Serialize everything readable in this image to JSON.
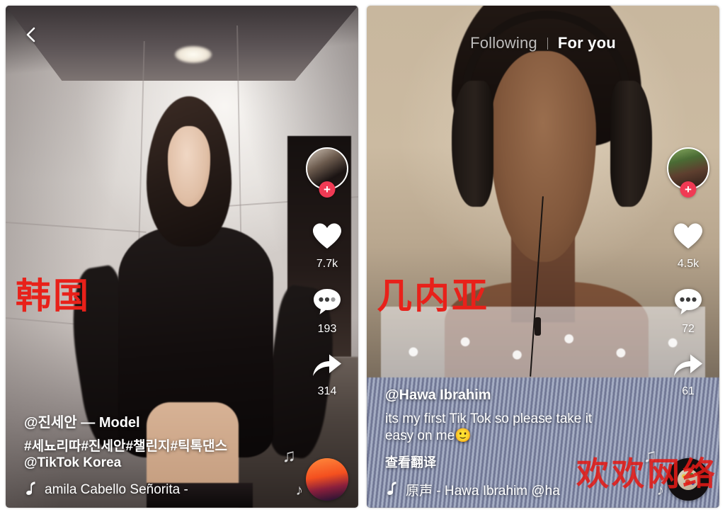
{
  "app": {
    "name": "TikTok",
    "accent_color": "#f03a54",
    "annotation_color": "#e8211a"
  },
  "left_panel": {
    "back_icon": "chevron-left-icon",
    "annotation": "韩国",
    "author": "@진세안 — Model",
    "caption_line1": "#세뇨리따#진세안#챌린지#틱톡댄스",
    "caption_line2": "@TikTok Korea",
    "music_icon": "music-note-icon",
    "music_text": "amila Cabello    Señorita  -",
    "actions": {
      "avatar_name": "avatar",
      "follow_label": "+",
      "like_icon": "heart-icon",
      "like_count": "7.7k",
      "comment_icon": "comment-bubble-icon",
      "comment_count": "193",
      "share_icon": "share-arrow-icon",
      "share_count": "314"
    }
  },
  "right_panel": {
    "annotation": "几内亚",
    "nav": {
      "following_label": "Following",
      "for_you_label": "For you"
    },
    "author": "@Hawa Ibrahim",
    "caption_line1": "its my first Tik Tok so please take it",
    "caption_line2": "easy on me",
    "caption_emoji": "🙂",
    "translate_label": "查看翻译",
    "music_icon": "music-note-icon",
    "music_text": "原声 - Hawa Ibrahim     @ha",
    "actions": {
      "avatar_name": "avatar",
      "follow_label": "+",
      "like_icon": "heart-icon",
      "like_count": "4.5k",
      "comment_icon": "comment-bubble-icon",
      "comment_count": "72",
      "share_icon": "share-arrow-icon",
      "share_count": "61"
    },
    "watermark": "欢欢网络"
  }
}
